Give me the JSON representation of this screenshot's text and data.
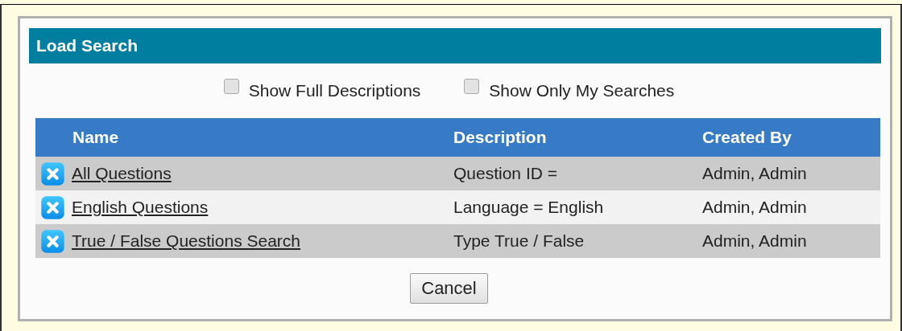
{
  "dialog": {
    "title": "Load Search"
  },
  "options": [
    {
      "label": "Show Full Descriptions",
      "checked": false
    },
    {
      "label": "Show Only My Searches",
      "checked": false
    }
  ],
  "table": {
    "columns": [
      "Name",
      "Description",
      "Created By"
    ],
    "rows": [
      {
        "name": "All Questions",
        "description": "Question ID =",
        "created_by": "Admin, Admin"
      },
      {
        "name": "English Questions",
        "description": "Language = English",
        "created_by": "Admin, Admin"
      },
      {
        "name": "True / False Questions Search",
        "description": "Type True / False",
        "created_by": "Admin, Admin"
      }
    ]
  },
  "buttons": [
    "Cancel"
  ]
}
